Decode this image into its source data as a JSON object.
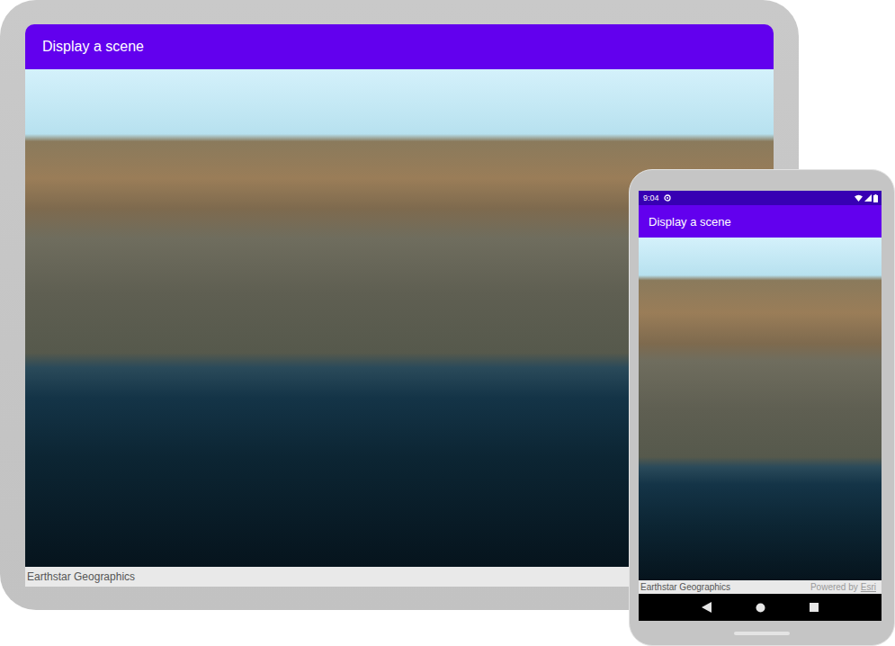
{
  "tablet": {
    "app_bar": {
      "title": "Display a scene"
    },
    "attribution": "Earthstar Geographics"
  },
  "phone": {
    "status_bar": {
      "time": "9:04"
    },
    "app_bar": {
      "title": "Display a scene"
    },
    "attribution": "Earthstar Geographics",
    "powered_by": {
      "prefix": "Powered by",
      "link": "Esri"
    }
  }
}
